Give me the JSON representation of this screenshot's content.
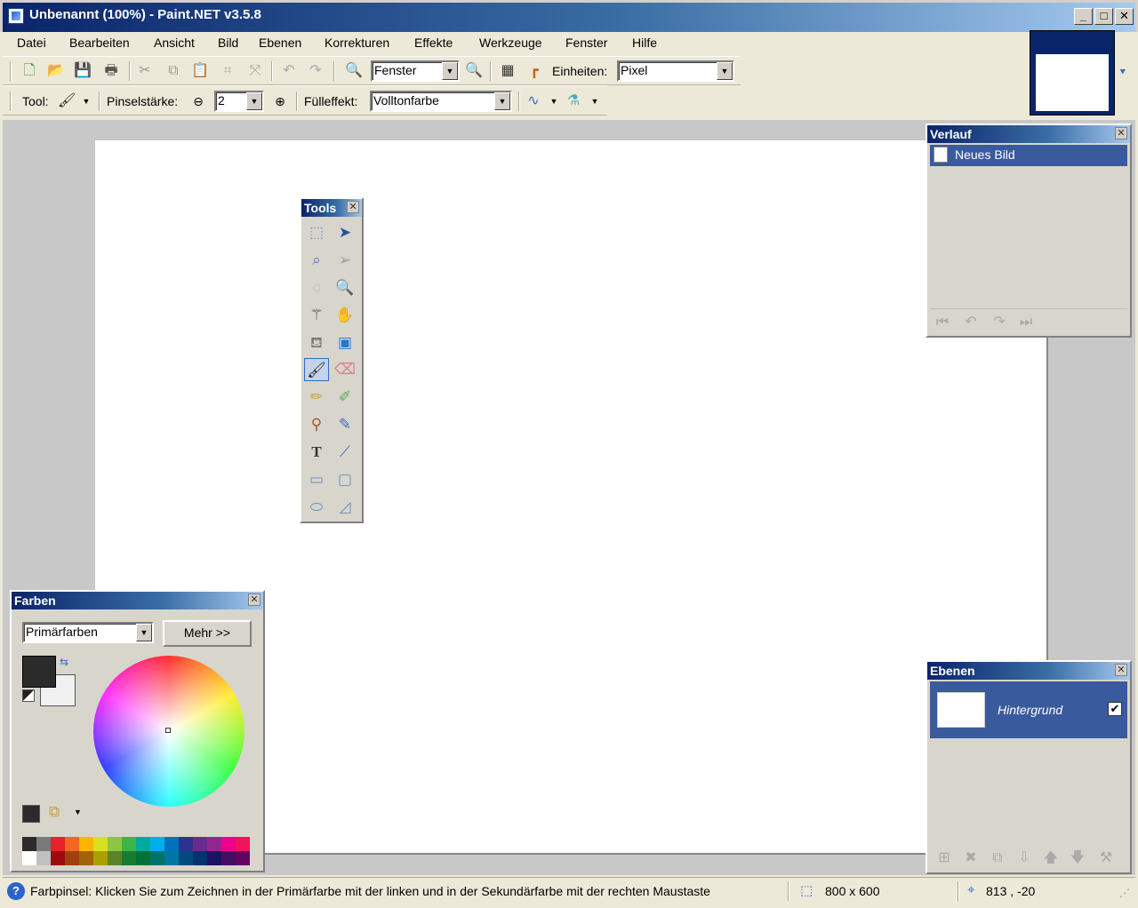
{
  "window": {
    "title": "Unbenannt (100%) - Paint.NET v3.5.8",
    "buttons": {
      "minimize": "_",
      "maximize": "□",
      "close": "✕"
    }
  },
  "menu": [
    "Datei",
    "Bearbeiten",
    "Ansicht",
    "Bild",
    "Ebenen",
    "Korrekturen",
    "Effekte",
    "Werkzeuge",
    "Fenster",
    "Hilfe"
  ],
  "toolbar": {
    "zoom_value": "Fenster",
    "units_label": "Einheiten:",
    "units_value": "Pixel"
  },
  "toolbar2": {
    "tool_label": "Tool:",
    "brush_width_label": "Pinselstärke:",
    "brush_width_value": "2",
    "fill_label": "Fülleffekt:",
    "fill_value": "Volltonfarbe"
  },
  "tools_panel": {
    "title": "Tools"
  },
  "history_panel": {
    "title": "Verlauf",
    "items": [
      "Neues Bild"
    ]
  },
  "layers_panel": {
    "title": "Ebenen",
    "layers": [
      {
        "name": "Hintergrund",
        "visible": true
      }
    ]
  },
  "colors_panel": {
    "title": "Farben",
    "mode_value": "Primärfarben",
    "more_button": "Mehr >>",
    "primary_color": "#2b2b2b",
    "secondary_color": "#f0f0f0",
    "palette_top": [
      "#2b2b2b",
      "#7a7a7a",
      "#e8202a",
      "#f26522",
      "#ffb400",
      "#d7e021",
      "#8dc63f",
      "#39b54a",
      "#00a99d",
      "#00aeef",
      "#0072bc",
      "#2e3192",
      "#662d91",
      "#92278f",
      "#ec008c",
      "#ed145b"
    ],
    "palette_bottom": [
      "#ffffff",
      "#c0c0c0",
      "#9e0b0f",
      "#a0410d",
      "#a36209",
      "#aba000",
      "#598527",
      "#197b30",
      "#007236",
      "#00746b",
      "#0076a3",
      "#004a80",
      "#003471",
      "#1b1464",
      "#440e62",
      "#630460"
    ]
  },
  "status": {
    "message": "Farbpinsel: Klicken Sie zum Zeichnen in der Primärfarbe mit der linken und in der Sekundärfarbe mit der rechten Maustaste",
    "image_size": "800 x 600",
    "cursor_pos": "813 , -20"
  }
}
